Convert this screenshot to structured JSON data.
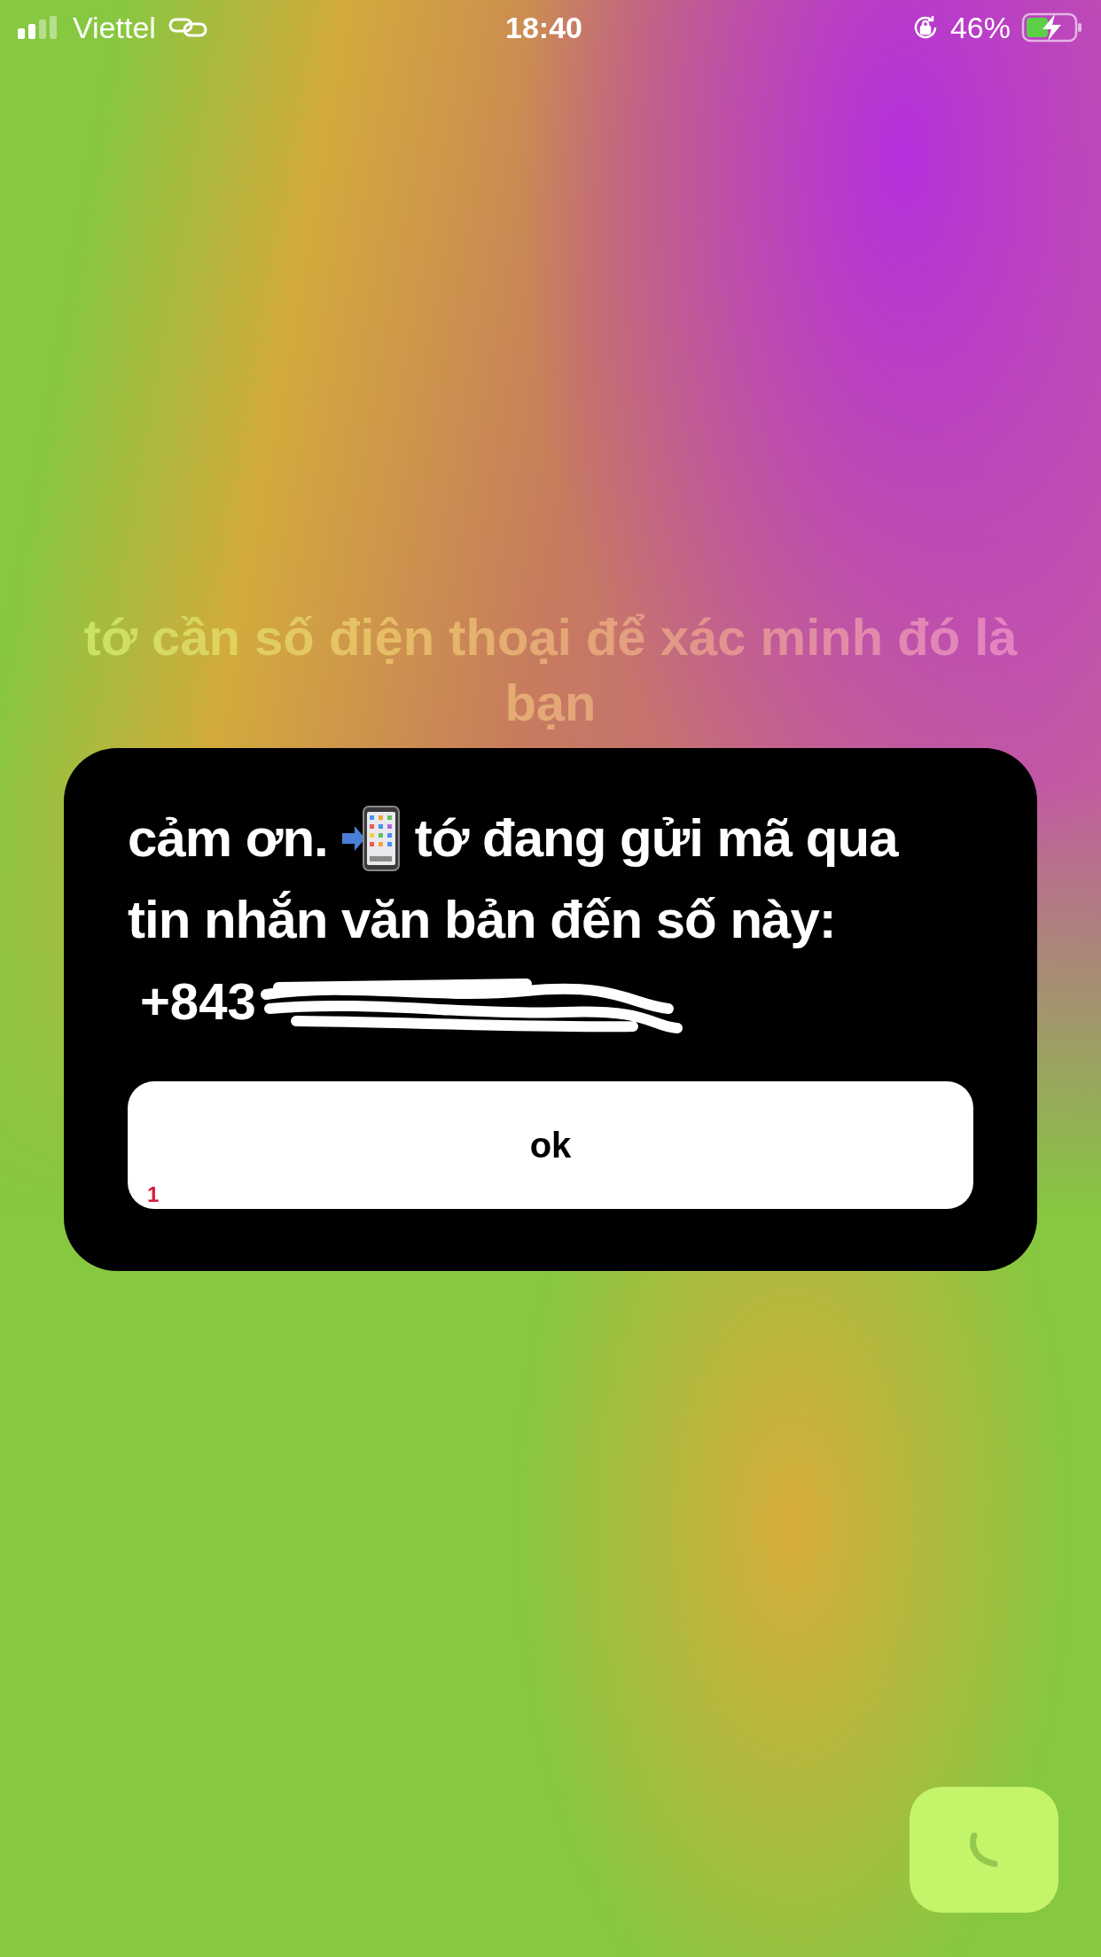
{
  "status_bar": {
    "carrier": "Viettel",
    "time": "18:40",
    "battery": "46%"
  },
  "prompt": "tớ cần số điện thoại để xác minh đó là bạn",
  "dialog": {
    "message_start": "cảm ơn.",
    "message_lines": [
      "tớ đang gửi mã qua",
      "tin nhắn văn bản đến số này:"
    ],
    "phone_number": "+843",
    "button": "ok",
    "badge": "1"
  }
}
